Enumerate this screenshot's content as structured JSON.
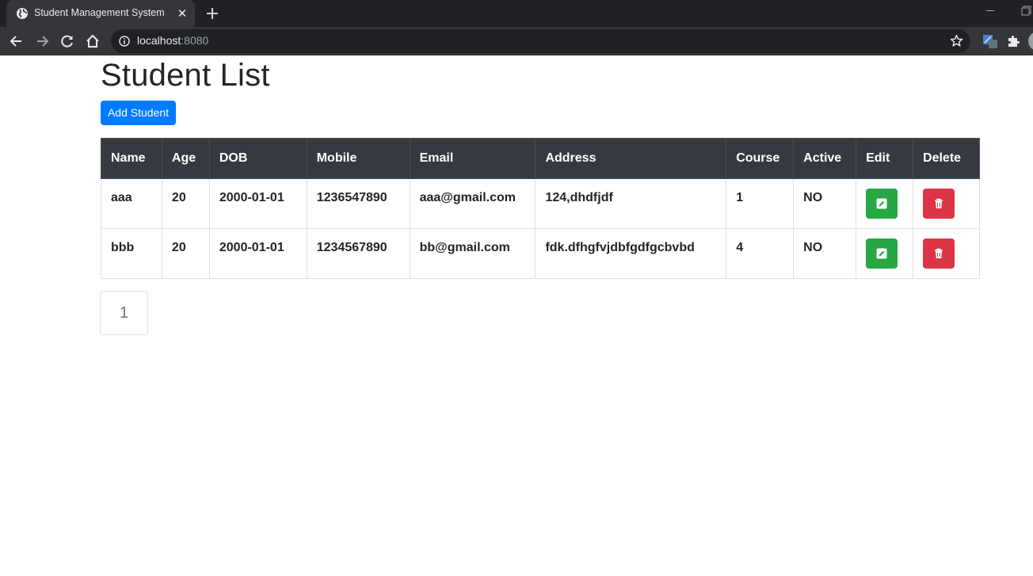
{
  "browser": {
    "tab_title": "Student Management System",
    "tab_close": "✕",
    "url_host": "localhost",
    "url_port": ":8080"
  },
  "page": {
    "title": "Student List",
    "add_button": "Add Student"
  },
  "table": {
    "headers": [
      "Name",
      "Age",
      "DOB",
      "Mobile",
      "Email",
      "Address",
      "Course",
      "Active",
      "Edit",
      "Delete"
    ],
    "rows": [
      {
        "name": "aaa",
        "age": "20",
        "dob": "2000-01-01",
        "mobile": "1236547890",
        "email": "aaa@gmail.com",
        "address": "124,dhdfjdf",
        "course": "1",
        "active": "NO"
      },
      {
        "name": "bbb",
        "age": "20",
        "dob": "2000-01-01",
        "mobile": "1234567890",
        "email": "bb@gmail.com",
        "address": "fdk.dfhgfvjdbfgdfgcbvbd",
        "course": "4",
        "active": "NO"
      }
    ],
    "edit_icon": "pencil-icon",
    "delete_icon": "trash-icon"
  },
  "pagination": {
    "current_page": "1"
  },
  "colors": {
    "primary": "#007bff",
    "success": "#28a745",
    "danger": "#dc3545",
    "header_dark": "#343a40"
  }
}
